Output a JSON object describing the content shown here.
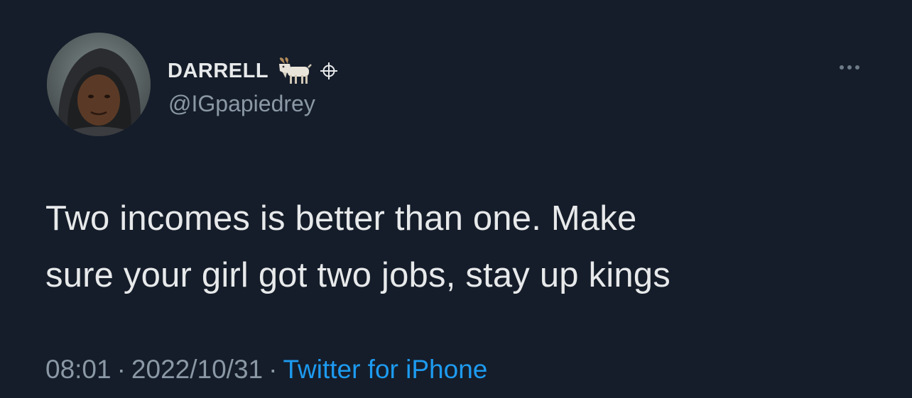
{
  "tweet": {
    "author": {
      "display_name": "DARRELL",
      "handle": "@IGpapiedrey"
    },
    "text_lines": [
      "Two incomes is better than one. Make",
      "sure your girl got two jobs, stay up kings"
    ],
    "time": "08:01",
    "separator": "·",
    "date": "2022/10/31",
    "source": "Twitter for iPhone"
  },
  "icons": {
    "goat": "goat-emoji-icon",
    "verified": "crosshair-symbol-icon",
    "more": "more-options-icon"
  },
  "colors": {
    "background": "#151d2a",
    "text": "#e7e9ea",
    "secondary": "#8b98a5",
    "link": "#1d9bf0"
  }
}
